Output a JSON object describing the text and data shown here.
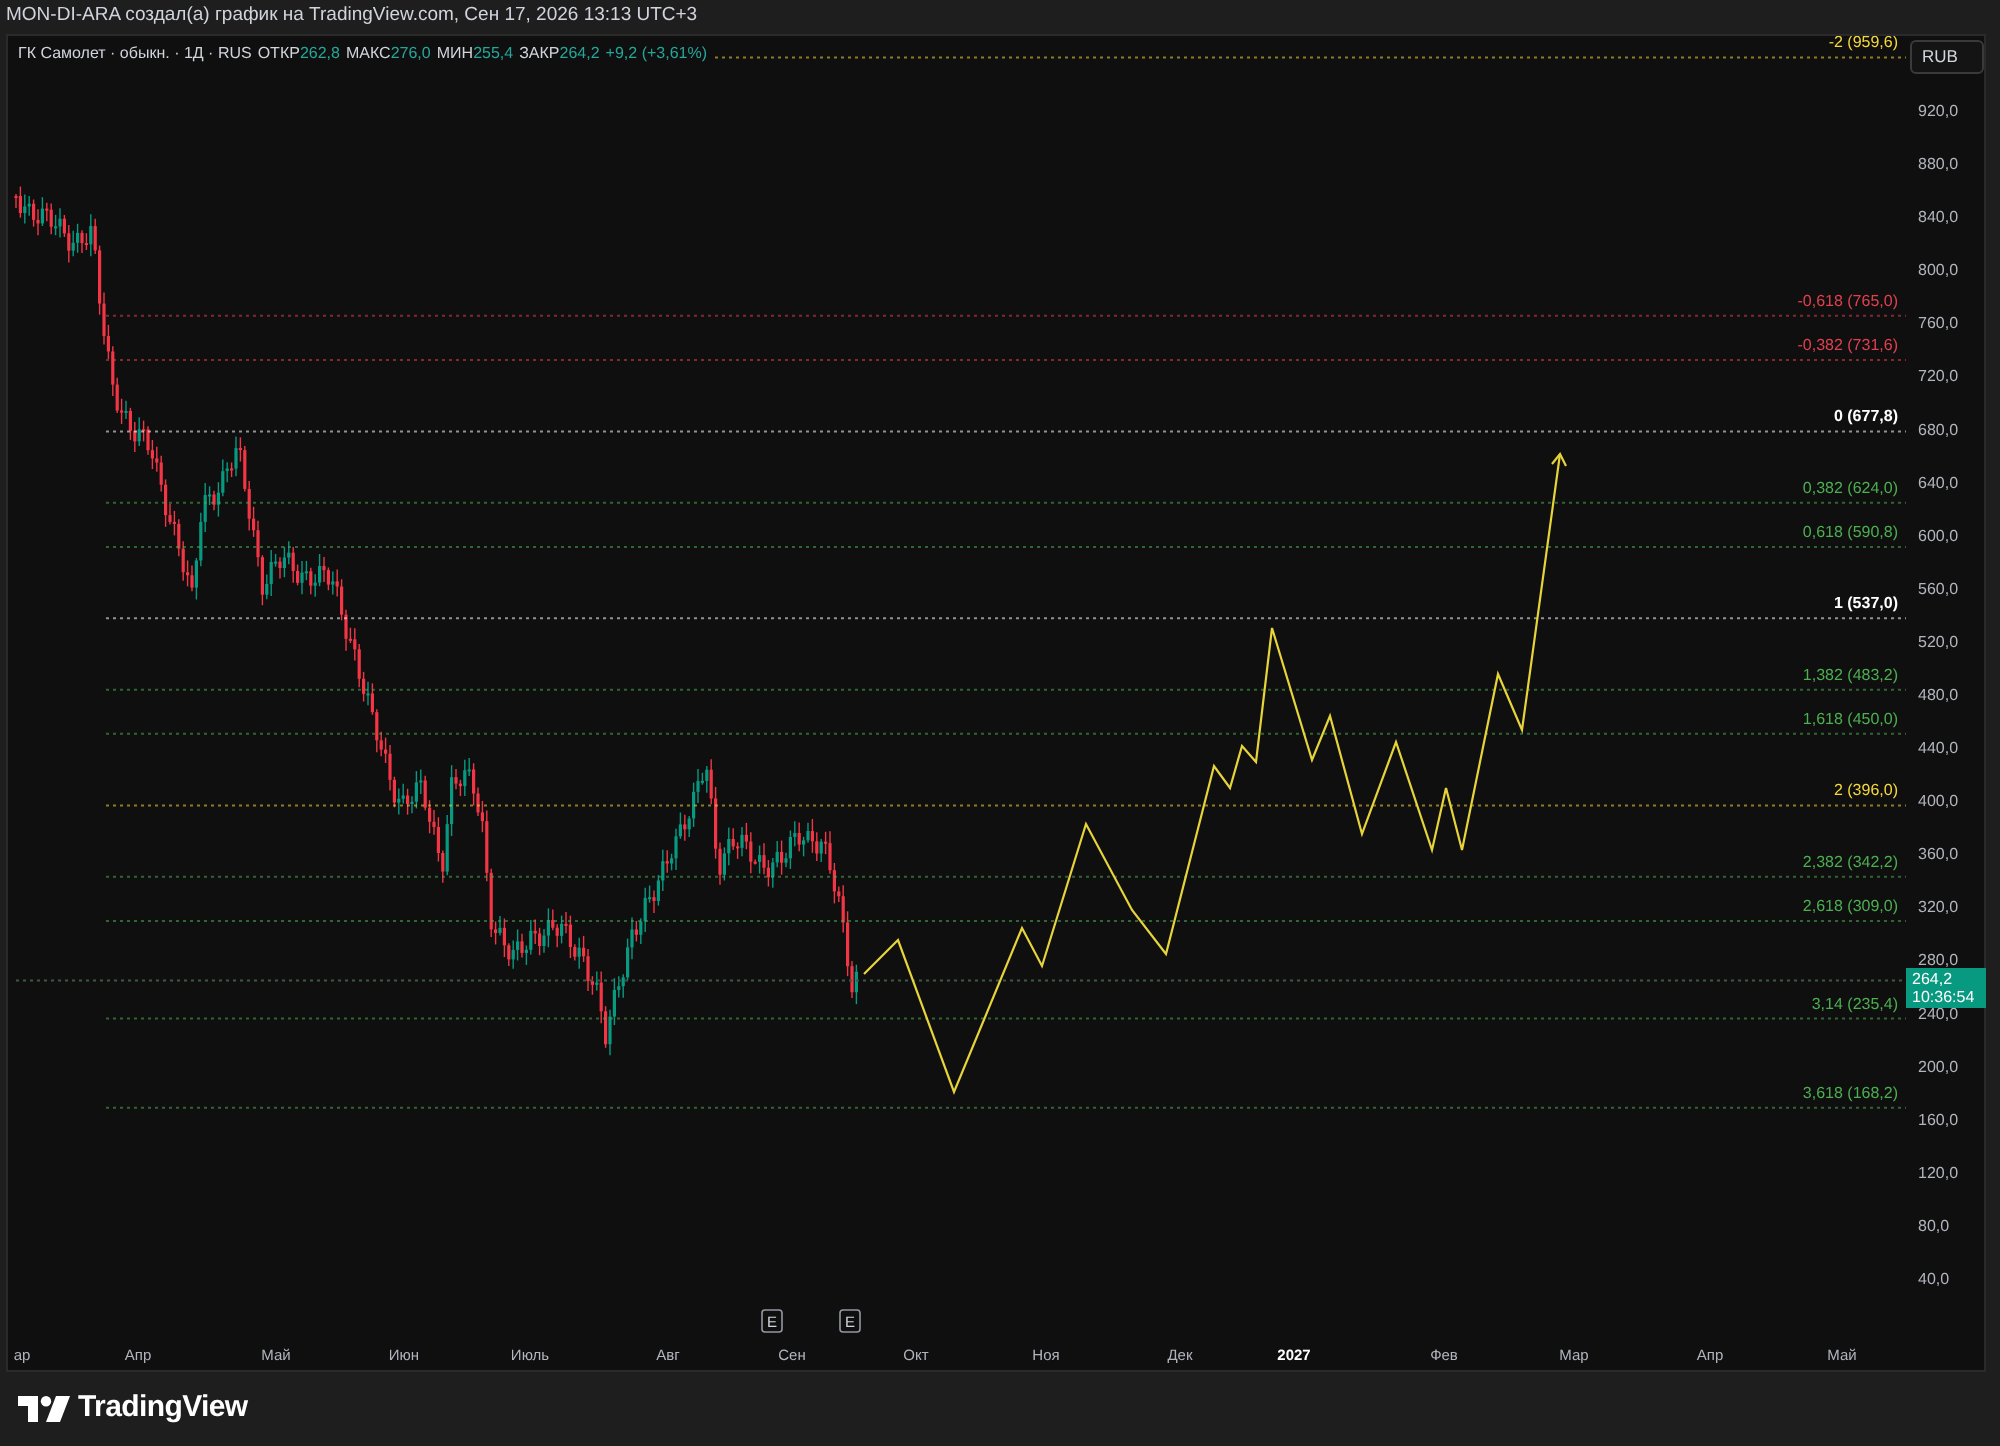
{
  "attribution": "MON-DI-ARA создал(а) график на TradingView.com, Сен 17, 2026 13:13 UTC+3",
  "legend": {
    "symbol": "ГК Самолет · обыкн. · 1Д · RUS",
    "fields": [
      {
        "label": "ОТКР",
        "value": "262,8"
      },
      {
        "label": "МАКС",
        "value": "276,0"
      },
      {
        "label": "МИН",
        "value": "255,4"
      },
      {
        "label": "ЗАКР",
        "value": "264,2"
      }
    ],
    "change": "+9,2 (+3,61%)"
  },
  "currency_button": "RUB",
  "fib_levels": [
    {
      "label": "-2 (959,6)",
      "color": "#f5d93b"
    },
    {
      "label": "-0,618 (765,0)",
      "color": "#e0404f"
    },
    {
      "label": "-0,382 (731,6)",
      "color": "#e0404f"
    },
    {
      "label": "0 (677,8)",
      "color": "#ffffff"
    },
    {
      "label": "0,382 (624,0)",
      "color": "#4caf50"
    },
    {
      "label": "0,618 (590,8)",
      "color": "#4caf50"
    },
    {
      "label": "1 (537,0)",
      "color": "#ffffff"
    },
    {
      "label": "1,382 (483,2)",
      "color": "#4caf50"
    },
    {
      "label": "1,618 (450,0)",
      "color": "#4caf50"
    },
    {
      "label": "2 (396,0)",
      "color": "#f5d93b"
    },
    {
      "label": "2,382 (342,2)",
      "color": "#4caf50"
    },
    {
      "label": "2,618 (309,0)",
      "color": "#4caf50"
    },
    {
      "label": "3,14 (235,4)",
      "color": "#4caf50"
    },
    {
      "label": "3,618 (168,2)",
      "color": "#4caf50"
    }
  ],
  "price_axis": [
    "920,0",
    "880,0",
    "840,0",
    "800,0",
    "760,0",
    "720,0",
    "680,0",
    "640,0",
    "600,0",
    "560,0",
    "520,0",
    "480,0",
    "440,0",
    "400,0",
    "360,0",
    "320,0",
    "280,0",
    "240,0",
    "200,0",
    "160,0",
    "120,0",
    "80,0",
    "40,0"
  ],
  "price_badge": {
    "price": "264,2",
    "countdown": "10:36:54"
  },
  "events": [
    {
      "label": "E"
    },
    {
      "label": "E"
    }
  ],
  "time_axis": [
    {
      "label": "ар",
      "kind": "month"
    },
    {
      "label": "Апр",
      "kind": "month"
    },
    {
      "label": "Май",
      "kind": "month"
    },
    {
      "label": "Июн",
      "kind": "month"
    },
    {
      "label": "Июль",
      "kind": "month"
    },
    {
      "label": "Авг",
      "kind": "month"
    },
    {
      "label": "Сен",
      "kind": "month"
    },
    {
      "label": "Окт",
      "kind": "month"
    },
    {
      "label": "Ноя",
      "kind": "month"
    },
    {
      "label": "Дек",
      "kind": "month"
    },
    {
      "label": "2027",
      "kind": "year"
    },
    {
      "label": "Фев",
      "kind": "month"
    },
    {
      "label": "Мар",
      "kind": "month"
    },
    {
      "label": "Апр",
      "kind": "month"
    },
    {
      "label": "Май",
      "kind": "month"
    }
  ],
  "brand": "TradingView"
}
